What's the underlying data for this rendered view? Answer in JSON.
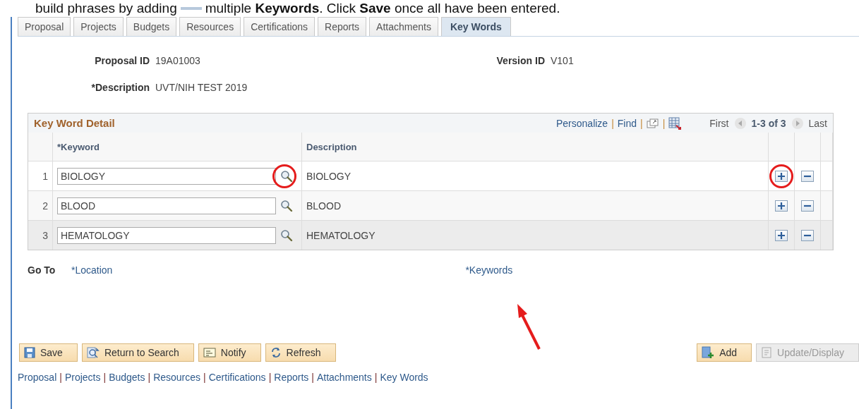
{
  "instruction": {
    "lead": "build phrases by adding",
    "rest": "multiple **Keywords**. Click **Save** once all have been entered."
  },
  "tabs": [
    {
      "label": "Proposal",
      "selected": false
    },
    {
      "label": "Projects",
      "selected": false
    },
    {
      "label": "Budgets",
      "selected": false
    },
    {
      "label": "Resources",
      "selected": false
    },
    {
      "label": "Certifications",
      "selected": false
    },
    {
      "label": "Reports",
      "selected": false
    },
    {
      "label": "Attachments",
      "selected": false
    },
    {
      "label": "Key Words",
      "selected": true
    }
  ],
  "header": {
    "proposal_id": {
      "label": "Proposal ID",
      "value": "19A01003"
    },
    "version_id": {
      "label": "Version ID",
      "value": "V101"
    },
    "description": {
      "label": "*Description",
      "value": "UVT/NIH TEST 2019"
    }
  },
  "grid": {
    "separator": "|",
    "title": "Key Word Detail",
    "personalize": "Personalize",
    "find": "Find",
    "first": "First",
    "range": "1-3 of 3",
    "last": "Last",
    "columns": [
      "*Keyword",
      "Description"
    ],
    "rows": [
      {
        "number": "1",
        "keyword": "BIOLOGY",
        "description": "BIOLOGY",
        "circled": true
      },
      {
        "number": "2",
        "keyword": "BLOOD",
        "description": "BLOOD",
        "circled": false
      },
      {
        "number": "3",
        "keyword": "HEMATOLOGY",
        "description": "HEMATOLOGY",
        "circled": false
      }
    ]
  },
  "go_to": {
    "label": "Go To",
    "links": [
      "*Location",
      "*Keywords"
    ]
  },
  "buttons_left": [
    {
      "label": "Save",
      "kind": "save",
      "disabled": false
    },
    {
      "label": "Return to Search",
      "kind": "search",
      "disabled": false
    },
    {
      "label": "Notify",
      "kind": "notify",
      "disabled": false
    },
    {
      "label": "Refresh",
      "kind": "refresh",
      "disabled": false
    }
  ],
  "buttons_right": [
    {
      "label": "Add",
      "kind": "add",
      "disabled": false
    },
    {
      "label": "Update/Display",
      "kind": "update",
      "disabled": true
    }
  ],
  "footer_separator": "|",
  "footer_links": [
    "Proposal",
    "Projects",
    "Budgets",
    "Resources",
    "Certifications",
    "Reports",
    "Attachments",
    "Key Words"
  ]
}
